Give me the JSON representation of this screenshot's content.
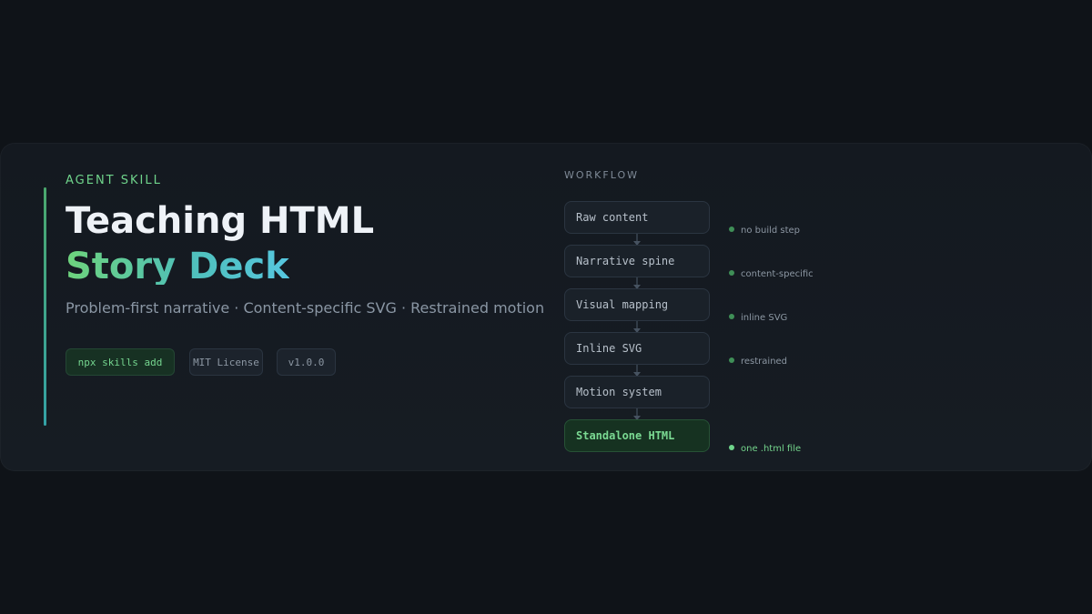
{
  "hero": {
    "eyebrow": "AGENT SKILL",
    "title_line1": "Teaching HTML",
    "title_line2": "Story Deck",
    "subtitle": "Problem-first narrative · Content-specific SVG · Restrained motion",
    "tags": {
      "install": "npx skills add",
      "license": "MIT License",
      "version": "v1.0.0"
    }
  },
  "workflow": {
    "label": "WORKFLOW",
    "steps": [
      "Raw content",
      "Narrative spine",
      "Visual mapping",
      "Inline SVG",
      "Motion system",
      "Standalone HTML"
    ],
    "notes": [
      "no build step",
      "content-specific",
      "inline SVG",
      "restrained",
      "one .html file"
    ]
  },
  "colors": {
    "background": "#0f1318",
    "card": "#141920",
    "accent_green": "#6fd48b",
    "accent_teal": "#4fc0ba",
    "text_primary": "#eef2f7",
    "text_secondary": "#8a96a4"
  },
  "icons": {
    "note_bullet": "dot-icon",
    "step_link": "arrow-down-icon"
  }
}
